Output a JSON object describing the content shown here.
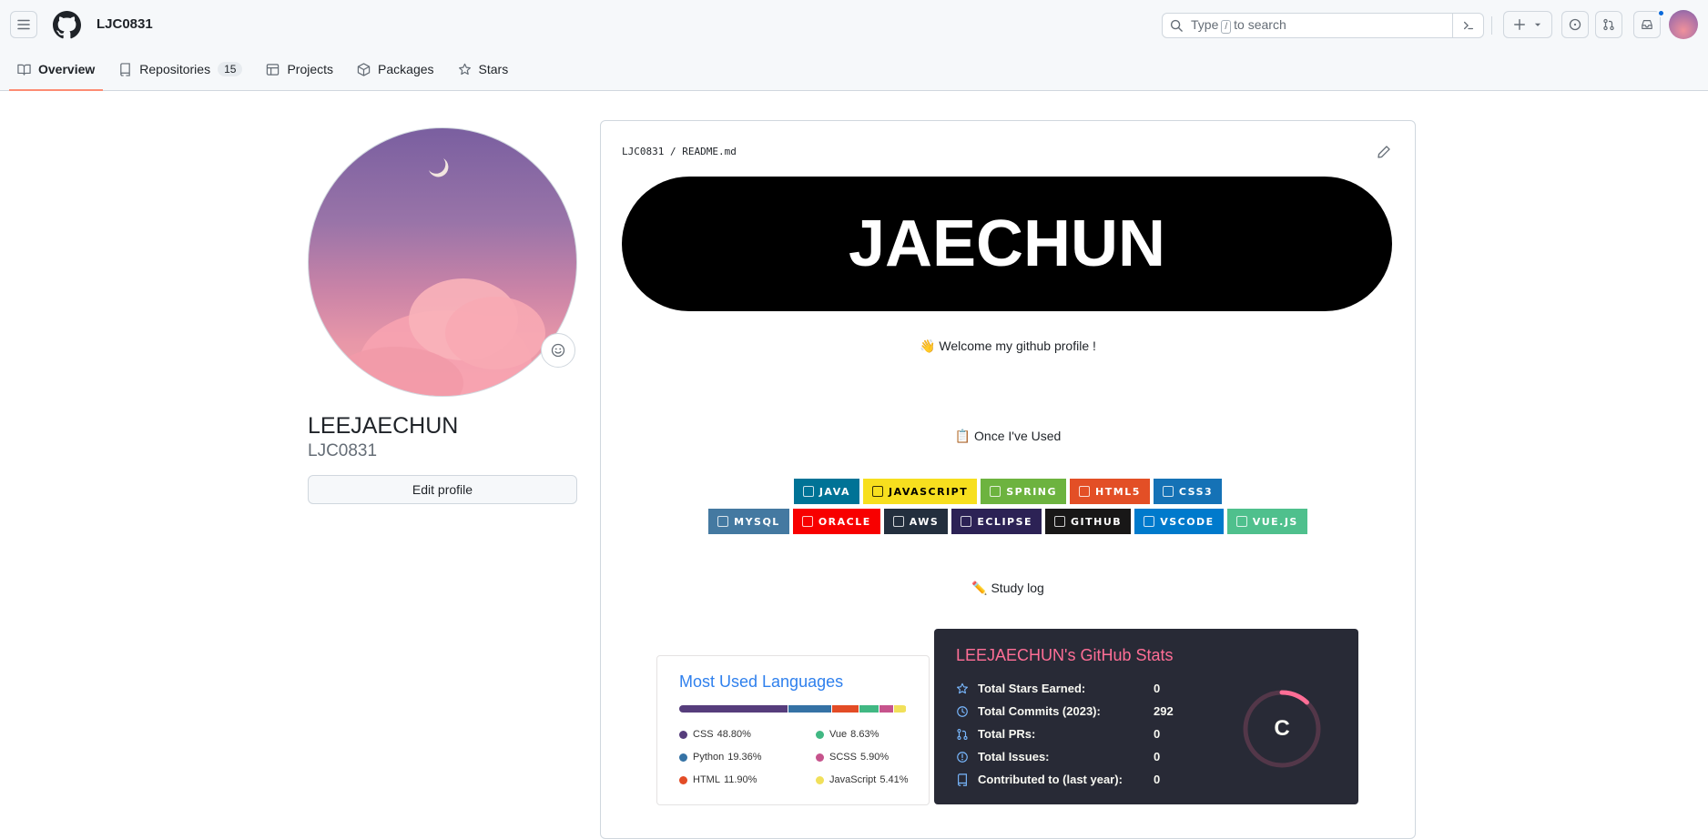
{
  "header": {
    "username": "LJC0831",
    "search_prefix": "Type",
    "search_key": "/",
    "search_suffix": "to search"
  },
  "tabs": [
    {
      "label": "Overview",
      "icon": "book-icon"
    },
    {
      "label": "Repositories",
      "count": "15",
      "icon": "repo-icon"
    },
    {
      "label": "Projects",
      "icon": "table-icon"
    },
    {
      "label": "Packages",
      "icon": "package-icon"
    },
    {
      "label": "Stars",
      "icon": "star-icon"
    }
  ],
  "profile": {
    "full_name": "LEEJAECHUN",
    "login": "LJC0831",
    "edit_label": "Edit profile"
  },
  "readme": {
    "path": "LJC0831 / README.md",
    "banner": "JAECHUN",
    "welcome": "👋 Welcome my github profile !",
    "used_heading": "📋 Once I've Used",
    "study_heading": "✏️ Study log",
    "badges_row1": [
      {
        "label": "JAVA",
        "bg": "#007396",
        "fg": "#ffffff"
      },
      {
        "label": "JAVASCRIPT",
        "bg": "#F7DF1E",
        "fg": "#000000"
      },
      {
        "label": "SPRING",
        "bg": "#6DB33F",
        "fg": "#ffffff"
      },
      {
        "label": "HTML5",
        "bg": "#E34F26",
        "fg": "#ffffff"
      },
      {
        "label": "CSS3",
        "bg": "#1572B6",
        "fg": "#ffffff"
      }
    ],
    "badges_row2": [
      {
        "label": "MYSQL",
        "bg": "#4479A1",
        "fg": "#ffffff"
      },
      {
        "label": "ORACLE",
        "bg": "#F80000",
        "fg": "#ffffff"
      },
      {
        "label": "AWS",
        "bg": "#232F3E",
        "fg": "#ffffff"
      },
      {
        "label": "ECLIPSE",
        "bg": "#2C2255",
        "fg": "#ffffff"
      },
      {
        "label": "GITHUB",
        "bg": "#181717",
        "fg": "#ffffff"
      },
      {
        "label": "VSCODE",
        "bg": "#007ACC",
        "fg": "#ffffff"
      },
      {
        "label": "VUE.JS",
        "bg": "#4FC08D",
        "fg": "#ffffff"
      }
    ]
  },
  "languages_card": {
    "title": "Most Used Languages",
    "items": [
      {
        "name": "CSS",
        "pct": "48.80%",
        "value": 48.8,
        "color": "#563d7c"
      },
      {
        "name": "Python",
        "pct": "19.36%",
        "value": 19.36,
        "color": "#3572A5"
      },
      {
        "name": "HTML",
        "pct": "11.90%",
        "value": 11.9,
        "color": "#e34c26"
      },
      {
        "name": "Vue",
        "pct": "8.63%",
        "value": 8.63,
        "color": "#41b883"
      },
      {
        "name": "SCSS",
        "pct": "5.90%",
        "value": 5.9,
        "color": "#c6538c"
      },
      {
        "name": "JavaScript",
        "pct": "5.41%",
        "value": 5.41,
        "color": "#f1e05a"
      }
    ]
  },
  "stats_card": {
    "title": "LEEJAECHUN's GitHub Stats",
    "rows": [
      {
        "label": "Total Stars Earned:",
        "value": "0",
        "icon": "star-icon"
      },
      {
        "label": "Total Commits (2023):",
        "value": "292",
        "icon": "history-icon"
      },
      {
        "label": "Total PRs:",
        "value": "0",
        "icon": "pull-request-icon"
      },
      {
        "label": "Total Issues:",
        "value": "0",
        "icon": "issue-icon"
      },
      {
        "label": "Contributed to (last year):",
        "value": "0",
        "icon": "repo-icon"
      }
    ],
    "rank": "C",
    "rank_progress": 0.12,
    "accent": "#ff6e96"
  }
}
